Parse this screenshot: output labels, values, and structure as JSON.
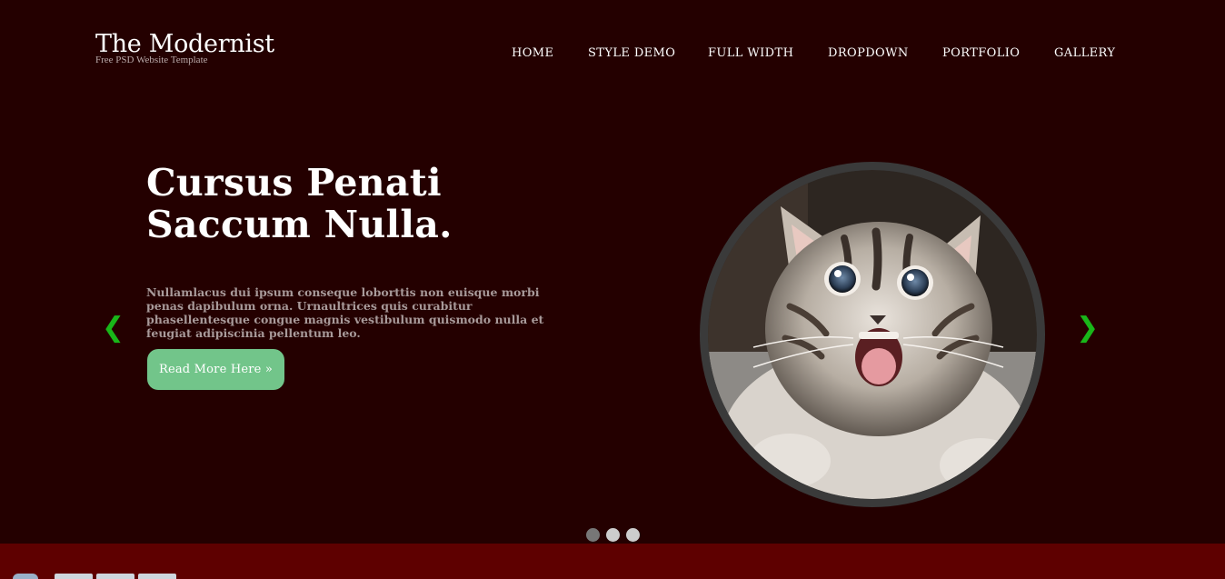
{
  "brand": {
    "title": "The Modernist",
    "subtitle": "Free PSD Website Template"
  },
  "nav": {
    "items": [
      {
        "label": "HOME"
      },
      {
        "label": "STYLE DEMO"
      },
      {
        "label": "FULL WIDTH"
      },
      {
        "label": "DROPDOWN"
      },
      {
        "label": "PORTFOLIO"
      },
      {
        "label": "GALLERY"
      }
    ]
  },
  "hero": {
    "title_line1": "Cursus Penati",
    "title_line2": "Saccum Nulla.",
    "body": "Nullamlacus dui ipsum conseque loborttis non euisque morbi penas dapibulum orna. Urnaultrices quis curabitur phasellentesque congue magnis vestibulum quismodo nulla et feugiat adipiscinia pellentum leo.",
    "button_label": "Read More Here »",
    "image_icon": "kitten-photo"
  },
  "slider": {
    "prev_icon": "chevron-left-icon",
    "next_icon": "chevron-right-icon",
    "prev_glyph": "❮",
    "next_glyph": "❯",
    "dots": [
      {
        "active": true
      },
      {
        "active": false
      },
      {
        "active": false
      }
    ]
  },
  "colors": {
    "background": "#240000",
    "band": "#5e0000",
    "accent_button": "#72c58a",
    "arrow": "#19b619",
    "dot_active": "#777777",
    "dot_inactive": "#cccccc"
  }
}
